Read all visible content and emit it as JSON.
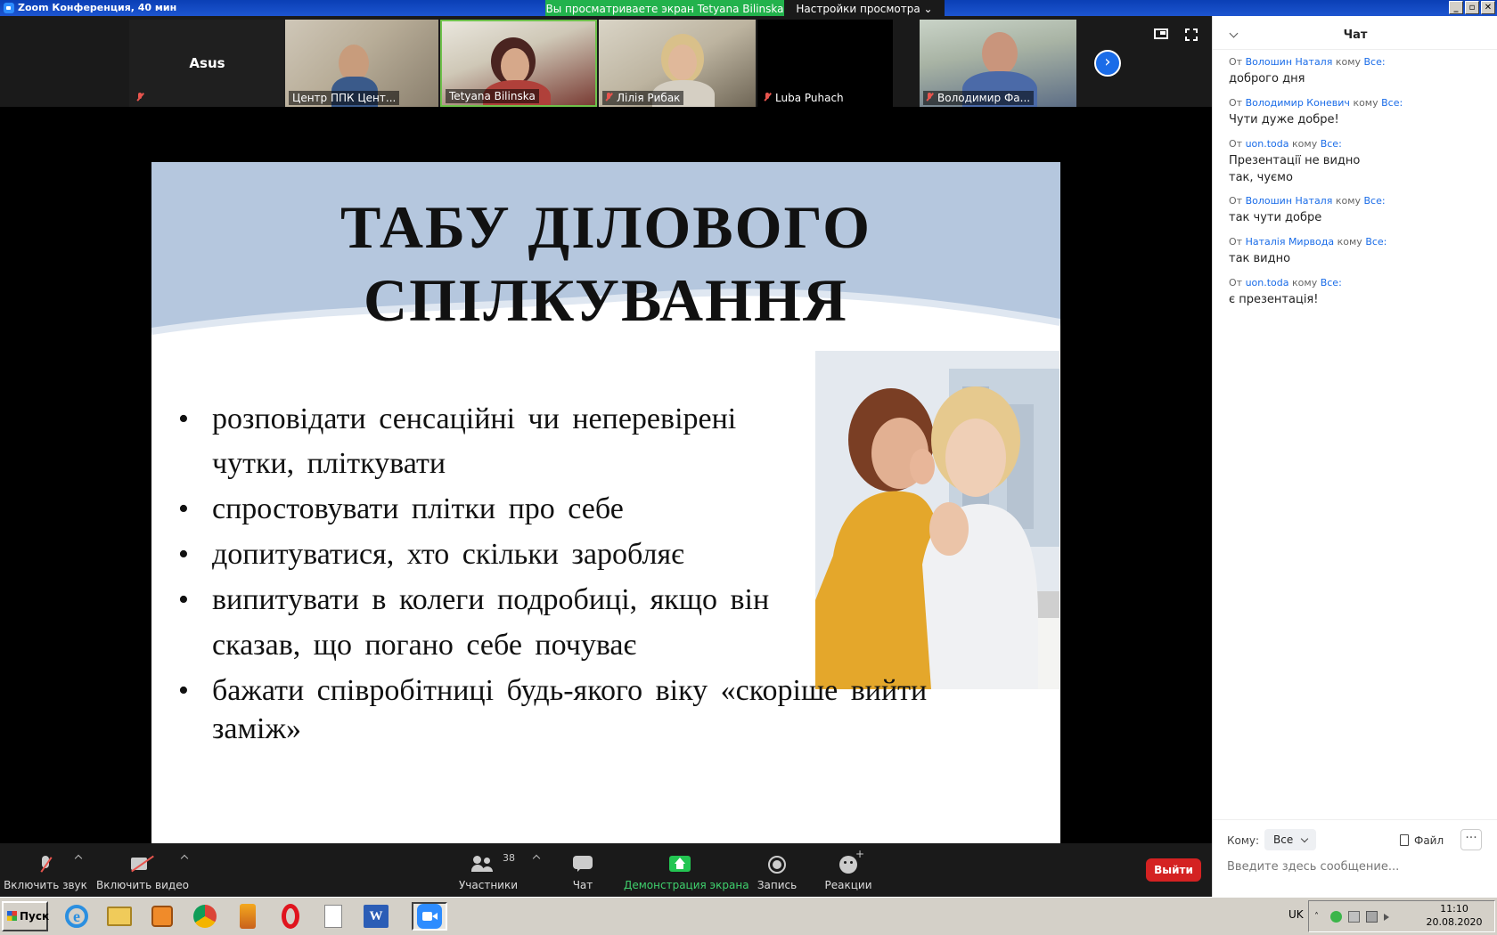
{
  "window": {
    "title": "Zoom Конференция, 40 мин",
    "share_banner": "Вы просматриваете экран Tetyana Bilinska",
    "view_options": "Настройки просмотра ⌄",
    "minimize": "_",
    "maximize": "▫",
    "close": "✕"
  },
  "participants": {
    "asus": "Asus",
    "tiles": [
      {
        "name": "Центр ППК Цент..."
      },
      {
        "name": "Tetyana Bilinska"
      },
      {
        "name": "Лілія Рибак"
      },
      {
        "name": "Luba Puhach"
      },
      {
        "name": "Володимир Фа..."
      }
    ],
    "next": "›"
  },
  "slide": {
    "title_line1": "ТАБУ ДІЛОВОГО",
    "title_line2": "СПІЛКУВАННЯ",
    "bullet": "•",
    "lines": [
      "розповідати  сенсаційні  чи  неперевірені",
      " чутки,  пліткувати",
      "спростовувати  плітки  про  себе",
      "допитуватися,  хто  скільки  заробляє",
      "випитувати  в  колеги  подробиці,  якщо  він",
      "сказав,  що  погано  себе  почуває",
      "бажати  співробітниці  будь-якого  віку  «скоріше  вийти",
      "заміж»"
    ]
  },
  "chat": {
    "title": "Чат",
    "from_word": "От",
    "to_word": "кому",
    "all_word": "Все:",
    "messages": [
      {
        "from": "Волошин Наталя",
        "text": "доброго дня"
      },
      {
        "from": "Володимир Коневич",
        "text": "Чути дуже добре!"
      },
      {
        "from": "uon.toda",
        "text": "Презентації не видно",
        "text2": "так, чуємо"
      },
      {
        "from": "Волошин Наталя",
        "text": "так чути добре"
      },
      {
        "from": "Наталія Мирвода",
        "text": "так видно"
      },
      {
        "from": "uon.toda",
        "text": "є презентація!"
      }
    ],
    "to_label": "Кому:",
    "to_value": "Все",
    "file_label": "Файл",
    "more": "···",
    "input_placeholder": "Введите здесь сообщение..."
  },
  "toolbar": {
    "mute": "Включить звук",
    "video": "Включить видео",
    "participants": "Участники",
    "participants_count": "38",
    "chat": "Чат",
    "share": "Демонстрация экрана",
    "record": "Запись",
    "reactions": "Реакции",
    "leave": "Выйти"
  },
  "taskbar": {
    "start": "Пуск",
    "lang": "UK",
    "time": "11:10",
    "date": "20.08.2020"
  },
  "colors": {
    "share_green": "#22b24c",
    "zoom_blue": "#1a6ce8",
    "leave_red": "#d42222",
    "slide_wave": "#b5c7de"
  }
}
